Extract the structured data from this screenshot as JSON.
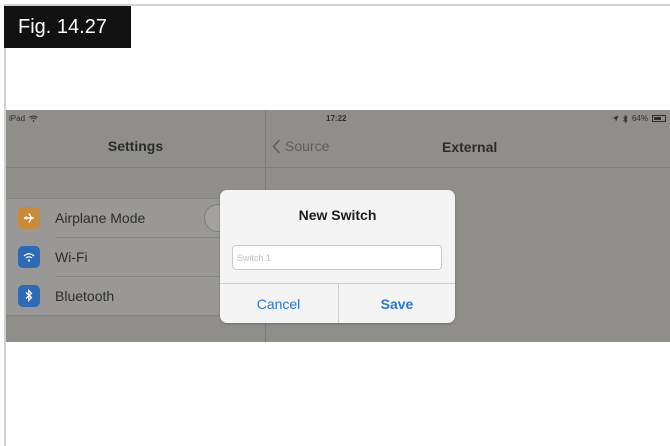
{
  "figure_label": "Fig. 14.27",
  "statusbar": {
    "device": "iPad",
    "wifi_icon": "wifi-icon",
    "time": "17:22",
    "location_icon": "location-arrow-icon",
    "bluetooth_icon": "bluetooth-icon",
    "battery": "64%",
    "battery_icon": "battery-icon"
  },
  "left_pane": {
    "title": "Settings",
    "items": [
      {
        "label": "Airplane Mode",
        "icon": "airplane-icon",
        "icon_color": "#c98a3a"
      },
      {
        "label": "Wi-Fi",
        "icon": "wifi-icon",
        "icon_color": "#2d6ab5"
      },
      {
        "label": "Bluetooth",
        "icon": "bluetooth-icon",
        "icon_color": "#2d6ab5"
      }
    ]
  },
  "right_pane": {
    "back_label": "Source",
    "title": "External"
  },
  "dialog": {
    "title": "New Switch",
    "input_placeholder": "Switch 1",
    "input_value": "",
    "cancel_label": "Cancel",
    "save_label": "Save",
    "accent_color": "#2a78d4"
  }
}
